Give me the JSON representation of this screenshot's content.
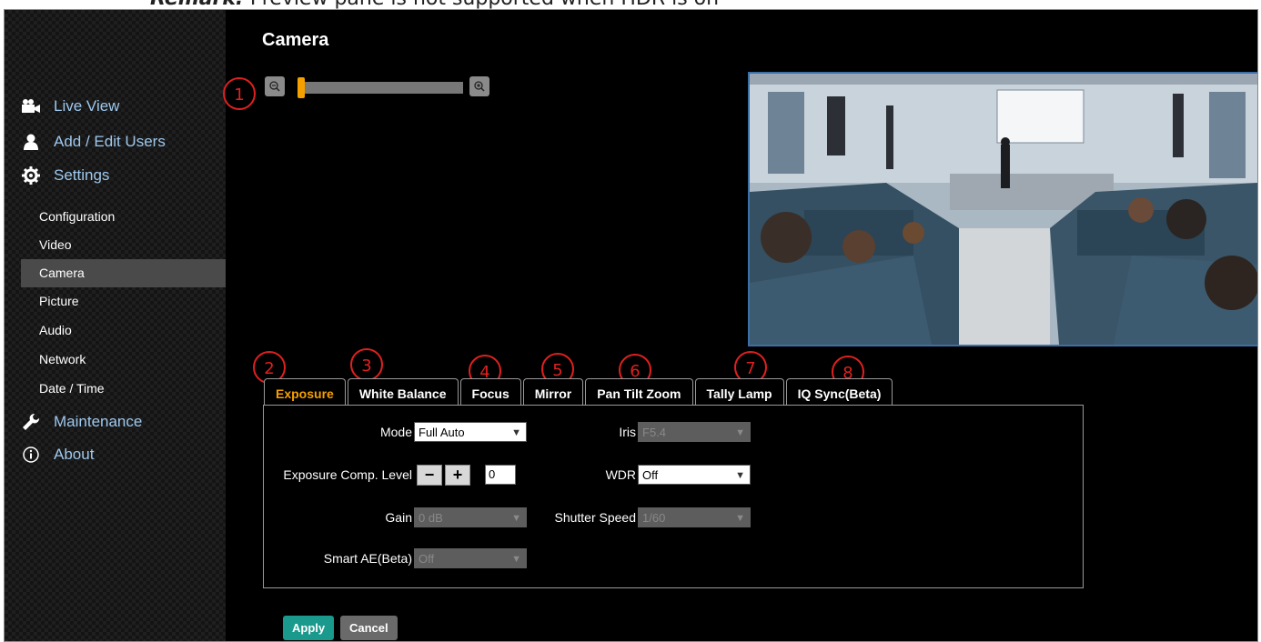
{
  "note": {
    "bold": "Remark:",
    "text": "Preview pane is not supported when HDR is on"
  },
  "page_title": "Camera",
  "sidebar": {
    "main": [
      {
        "label": "Live View",
        "icon": "video-camera-icon"
      },
      {
        "label": "Add / Edit Users",
        "icon": "user-icon"
      },
      {
        "label": "Settings",
        "icon": "gear-icon"
      },
      {
        "label": "Maintenance",
        "icon": "wrench-icon"
      },
      {
        "label": "About",
        "icon": "info-icon"
      }
    ],
    "settings_items": [
      "Configuration",
      "Video",
      "Camera",
      "Picture",
      "Audio",
      "Network",
      "Date / Time"
    ],
    "active_item": "Camera"
  },
  "zoom": {
    "out_icon": "zoom-out-icon",
    "in_icon": "zoom-in-icon",
    "level": 0
  },
  "markers": [
    "1",
    "2",
    "3",
    "4",
    "5",
    "6",
    "7",
    "8"
  ],
  "tabs": [
    {
      "label": "Exposure",
      "active": true
    },
    {
      "label": "White Balance"
    },
    {
      "label": "Focus"
    },
    {
      "label": "Mirror"
    },
    {
      "label": "Pan Tilt Zoom"
    },
    {
      "label": "Tally Lamp"
    },
    {
      "label": "IQ Sync(Beta)"
    }
  ],
  "exposure": {
    "mode": {
      "label": "Mode",
      "value": "Full Auto"
    },
    "comp": {
      "label": "Exposure Comp. Level",
      "value": "0",
      "minus": "−",
      "plus": "+"
    },
    "gain": {
      "label": "Gain",
      "value": "0 dB"
    },
    "smart_ae": {
      "label": "Smart AE(Beta)",
      "value": "Off"
    },
    "iris": {
      "label": "Iris",
      "value": "F5.4"
    },
    "wdr": {
      "label": "WDR",
      "value": "Off"
    },
    "shutter": {
      "label": "Shutter Speed",
      "value": "1/60"
    }
  },
  "actions": {
    "apply": "Apply",
    "cancel": "Cancel"
  },
  "colors": {
    "accent": "#f5a000",
    "apply": "#1a9a8c",
    "marker": "#e02020",
    "link": "#9ec8ee"
  }
}
